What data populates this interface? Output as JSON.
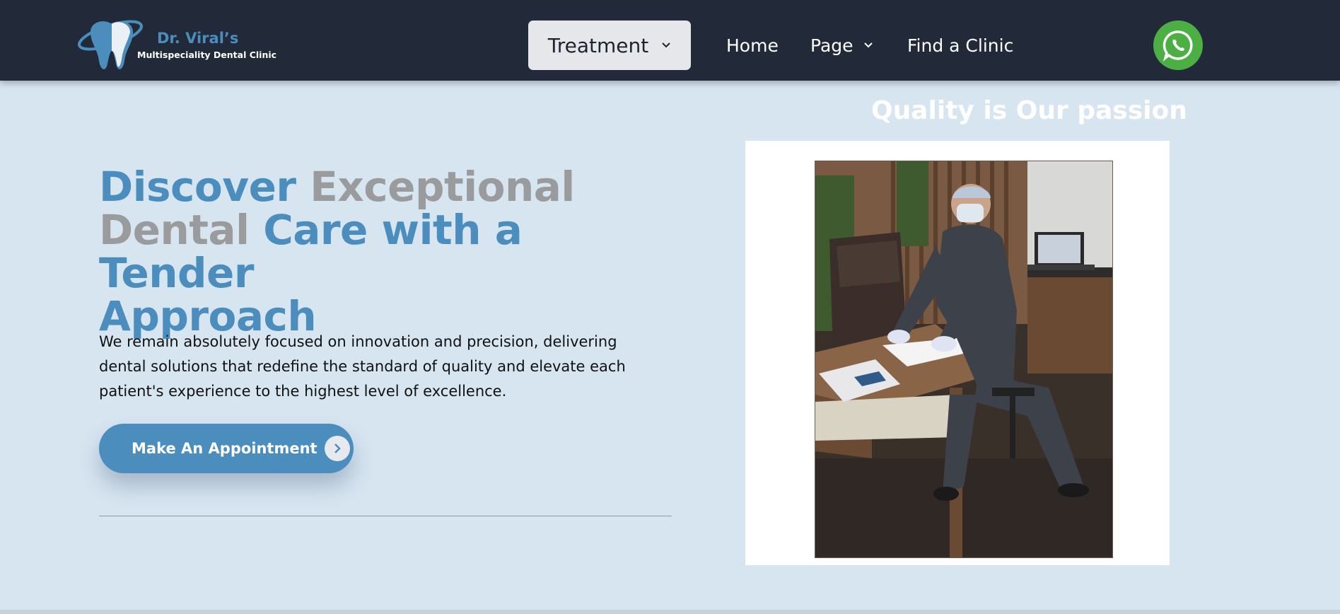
{
  "brand": {
    "name": "Dr. Viral’s",
    "subtitle": "Multispeciality Dental Clinic",
    "logo_icon": "tooth-icon",
    "colors": {
      "accent": "#4b8dbd",
      "header_bg": "#222a3a",
      "page_bg": "#d7e5f1",
      "whatsapp": "#4caf43"
    }
  },
  "nav": {
    "treatment": "Treatment",
    "home": "Home",
    "page": "Page",
    "find_clinic": "Find a Clinic",
    "whatsapp_icon": "whatsapp-icon"
  },
  "hero": {
    "title_parts": {
      "p1": "Discover ",
      "p2": "Exceptional",
      "p3": "Dental ",
      "p4": "Care with a Tender",
      "p5": "Approach"
    },
    "description": "We remain absolutely focused on innovation and precision, delivering dental solutions that redefine the standard of quality and elevate each patient's experience to the highest level of excellence.",
    "cta_label": "Make An Appointment",
    "cta_icon": "chevron-right-icon"
  },
  "side": {
    "tagline": "Quality is Our passion",
    "photo": "dentist-at-desk-photo"
  }
}
